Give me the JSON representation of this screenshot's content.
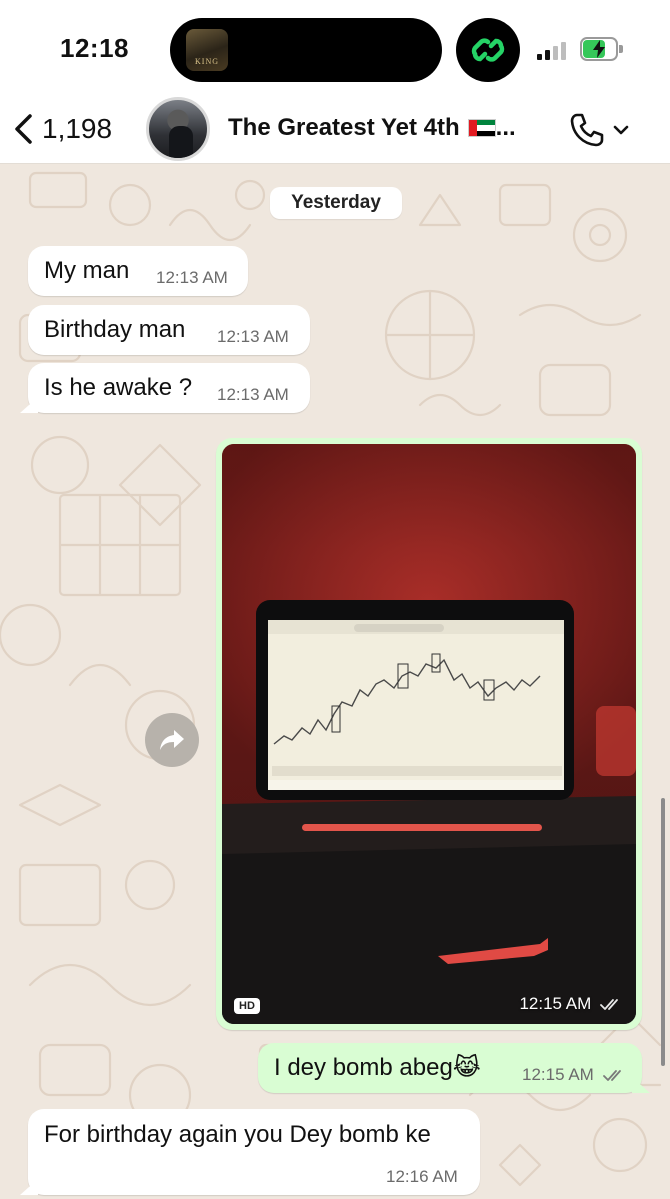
{
  "status_bar": {
    "time": "12:18",
    "island_art_text": "KING",
    "battery_color": "#35c759"
  },
  "header": {
    "back_count": "1,198",
    "title": "The Greatest Yet 4th",
    "title_suffix": "...",
    "icons": [
      "chevron-left-icon",
      "phone-icon",
      "chevron-down-icon"
    ]
  },
  "chat": {
    "date_chip": "Yesterday",
    "messages": [
      {
        "direction": "in",
        "text": "My man",
        "time": "12:13 AM"
      },
      {
        "direction": "in",
        "text": "Birthday man",
        "time": "12:13 AM"
      },
      {
        "direction": "in",
        "text": "Is he awake ?",
        "time": "12:13 AM"
      },
      {
        "direction": "out",
        "type": "image",
        "badge": "HD",
        "time": "12:15 AM",
        "status": "read"
      },
      {
        "direction": "out",
        "text": "I dey bomb abeg😹",
        "time": "12:15 AM",
        "status": "read"
      },
      {
        "direction": "in",
        "text": "For birthday again you Dey bomb ke",
        "time": "12:16 AM"
      }
    ]
  },
  "colors": {
    "outgoing_bubble": "#d9fdd3",
    "incoming_bubble": "#ffffff",
    "chat_background": "#efe7de",
    "accent_green": "#25d366"
  }
}
